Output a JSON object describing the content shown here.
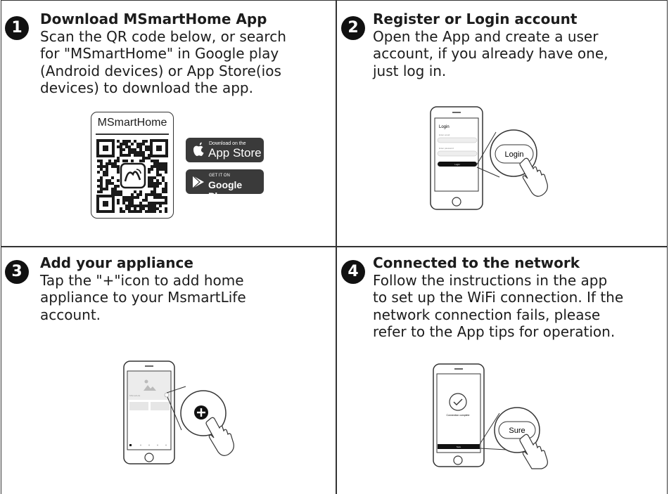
{
  "steps": [
    {
      "number": "1",
      "title": "Download MSmartHome App",
      "body": "Scan the QR code below, or search\nfor \"MSmartHome\" in Google play\n(Android devices) or App Store(ios\ndevices) to download the app."
    },
    {
      "number": "2",
      "title": "Register or Login account",
      "body": "Open the App and create a user\naccount, if you  already have one,\njust log in."
    },
    {
      "number": "3",
      "title": "Add your appliance",
      "body": "Tap the \"+\"icon to add home\nappliance to your MsmartLife\naccount."
    },
    {
      "number": "4",
      "title": "Connected to the network",
      "body": "Follow the instructions in the app\nto set up the WiFi connection. If the\nnetwork connection fails, please\nrefer to the App tips for operation."
    }
  ],
  "qr": {
    "label": "MSmartHome"
  },
  "stores": {
    "apple_small": "Download on the",
    "apple_big": "App Store",
    "google_small": "GET IT ON",
    "google_big": "Google Play"
  },
  "login_phone": {
    "screen_title": "Login",
    "field1": "Enter email",
    "field2": "Enter password",
    "button": "Login",
    "bubble": "Login"
  },
  "add_phone": {
    "caption": "MSmartLife",
    "bubble_icon": "plus-icon"
  },
  "network_phone": {
    "status": "Connection complete",
    "button": "Sure",
    "bubble": "Sure"
  }
}
